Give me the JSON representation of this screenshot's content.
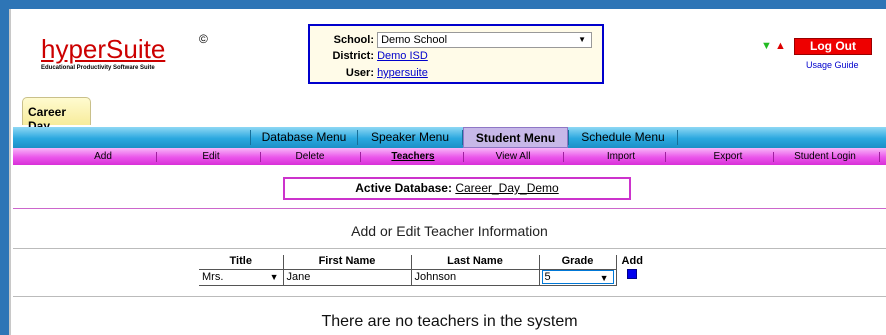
{
  "logo": {
    "name": "hyperSuite",
    "registered": "©",
    "tagline": "Educational Productivity Software Suite"
  },
  "context": {
    "school_label": "School:",
    "school_value": "Demo School",
    "district_label": "District:",
    "district_value": "Demo ISD",
    "user_label": "User:",
    "user_value": "hypersuite"
  },
  "header": {
    "arrow_down": "▼",
    "arrow_up": "▲",
    "logout_label": "Log Out",
    "usage_guide_label": "Usage Guide"
  },
  "app_tab": {
    "label": "Career Day"
  },
  "main_menu": {
    "items": [
      {
        "label": "Database Menu"
      },
      {
        "label": "Speaker Menu"
      },
      {
        "label": "Student Menu",
        "active": true
      },
      {
        "label": "Schedule Menu"
      }
    ]
  },
  "sub_menu": {
    "items": [
      {
        "label": "Add"
      },
      {
        "label": "Edit"
      },
      {
        "label": "Delete"
      },
      {
        "label": "Teachers",
        "active": true
      },
      {
        "label": "View All"
      },
      {
        "label": "Import"
      },
      {
        "label": "Export"
      },
      {
        "label": "Student Login"
      }
    ]
  },
  "active_database": {
    "label": "Active Database:",
    "value": "Career_Day_Demo"
  },
  "section_title": "Add or Edit Teacher Information",
  "teacher_form": {
    "headers": {
      "title": "Title",
      "first_name": "First Name",
      "last_name": "Last Name",
      "grade": "Grade",
      "add": "Add"
    },
    "values": {
      "title": "Mrs.",
      "first_name": "Jane",
      "last_name": "Johnson",
      "grade": "5"
    }
  },
  "empty_message": "There are no teachers in the system",
  "colors": {
    "logo_red": "#cc0000",
    "logout_red": "#ee0000",
    "menu_blue": "#2aa8df",
    "submenu_magenta": "#ea55ea",
    "active_tab": "#c7b8e8",
    "context_border": "#0000cc"
  }
}
